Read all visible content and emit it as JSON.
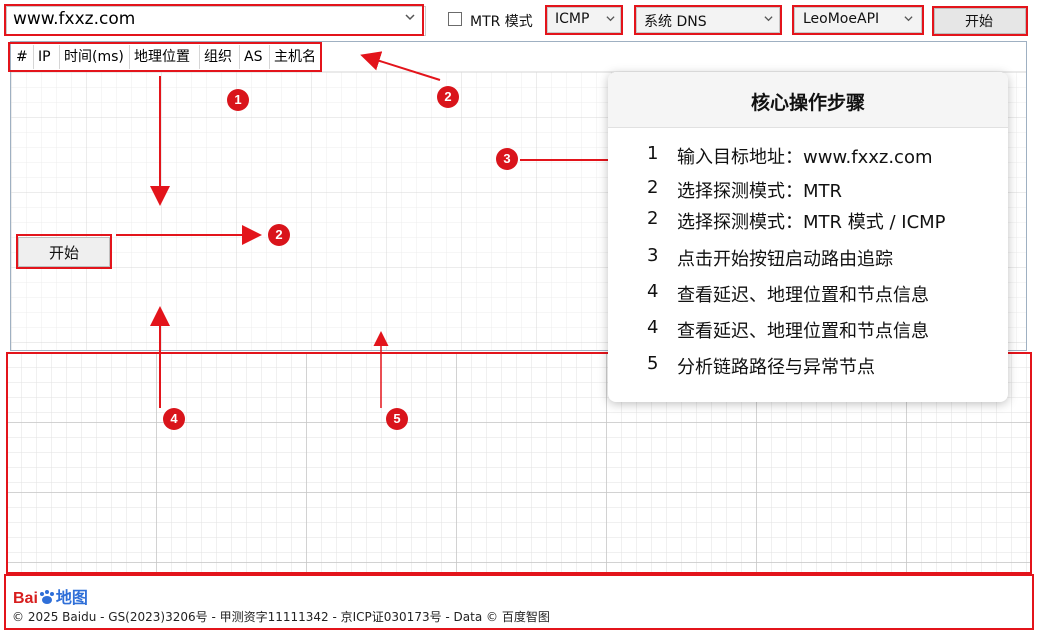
{
  "toolbar": {
    "url_value": "www.fxxz.com",
    "mtr_label": "MTR 模式",
    "protocol": "ICMP",
    "dns": "系统 DNS",
    "api": "LeoMoeAPI",
    "start_label": "开始"
  },
  "columns": [
    "#",
    "IP",
    "时间(ms)",
    "地理位置",
    "组织",
    "AS",
    "主机名"
  ],
  "main": {
    "start_label": "开始"
  },
  "markers": [
    "1",
    "2",
    "2",
    "3",
    "4",
    "5"
  ],
  "card": {
    "title": "核心操作步骤",
    "steps": [
      {
        "num": "1",
        "text": "输入目标地址：www.fxxz.com"
      },
      {
        "num": "2",
        "text": "选择探测模式：MTR"
      },
      {
        "num": "2",
        "text": "选择探测模式：MTR 模式 / ICMP"
      },
      {
        "num": "3",
        "text": "点击开始按钮启动路由追踪"
      },
      {
        "num": "4",
        "text": "查看延迟、地理位置和节点信息"
      },
      {
        "num": "4",
        "text": "查看延迟、地理位置和节点信息"
      },
      {
        "num": "5",
        "text": "分析链路路径与异常节点"
      }
    ]
  },
  "footer": {
    "logo_red": "Bai",
    "logo_blue": "地图",
    "copyright": "© 2025 Baidu - GS(2023)3206号 - 甲测资字11111342 - 京ICP证030173号 - Data © 百度智图"
  },
  "colors": {
    "annotation": "#e3141b",
    "marker": "#d9141b"
  }
}
